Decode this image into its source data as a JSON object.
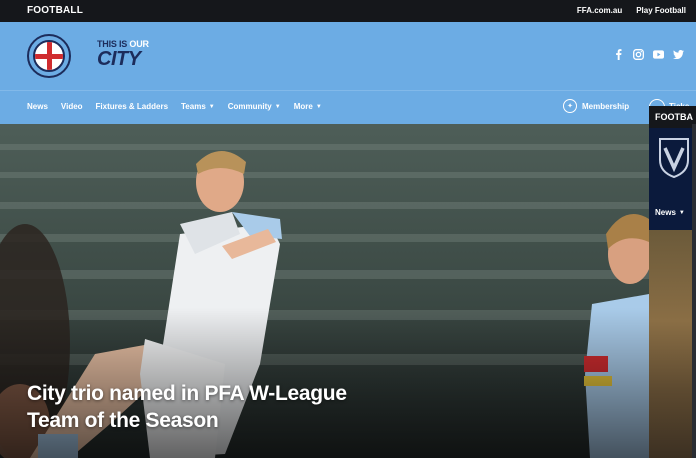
{
  "topbar": {
    "brand": "FOOTBALL",
    "links": [
      "FFA.com.au",
      "Play Football"
    ]
  },
  "header": {
    "tagline_line1_a": "THIS IS ",
    "tagline_line1_b": "OUR",
    "tagline_line2": "CITY",
    "social_icons": [
      "facebook-icon",
      "instagram-icon",
      "youtube-icon",
      "twitter-icon"
    ]
  },
  "nav": {
    "items": [
      "News",
      "Video",
      "Fixtures & Ladders",
      "Teams",
      "Community",
      "More"
    ],
    "membership": "Membership",
    "tickets": "Ticke"
  },
  "hero": {
    "headline": "City trio named in PFA W-League Team of the Season"
  },
  "side_panel": {
    "brand": "FOOTBA",
    "news": "News"
  },
  "colors": {
    "sky_blue": "#6cace4",
    "navy": "#1c2c5b",
    "topbar": "#15171b",
    "victory_navy": "#0b1a3c"
  }
}
